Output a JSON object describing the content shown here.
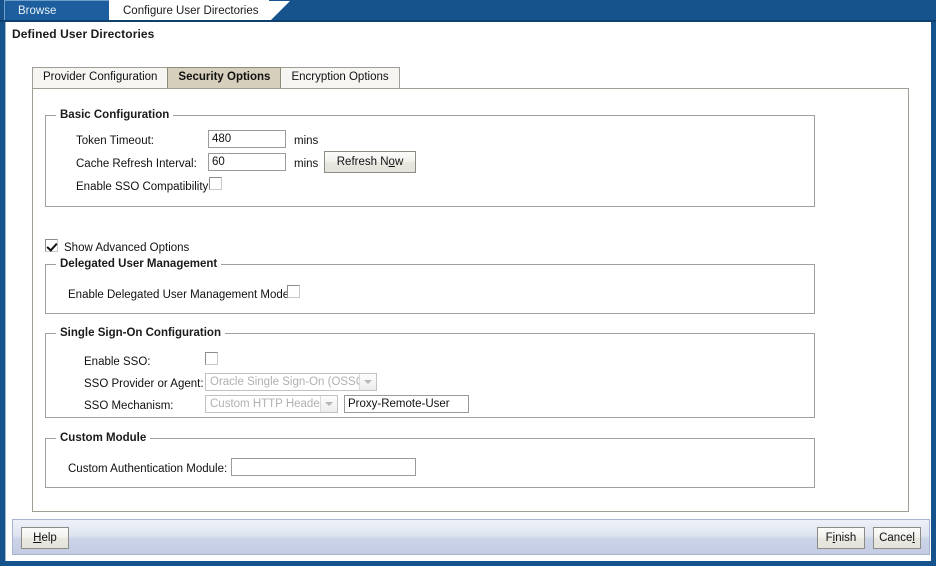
{
  "window": {
    "tabs": [
      {
        "label": "Browse",
        "active": false
      },
      {
        "label": "Configure User Directories",
        "active": true
      }
    ]
  },
  "page": {
    "title": "Defined User Directories"
  },
  "inner_tabs": [
    {
      "label": "Provider Configuration",
      "selected": false
    },
    {
      "label": "Security Options",
      "selected": true
    },
    {
      "label": "Encryption Options",
      "selected": false
    }
  ],
  "basic_configuration": {
    "legend": "Basic Configuration",
    "token_timeout": {
      "label": "Token Timeout:",
      "value": "480",
      "unit": "mins"
    },
    "cache_refresh_interval": {
      "label": "Cache Refresh Interval:",
      "value": "60",
      "unit": "mins"
    },
    "refresh_now_button": "Refresh Now",
    "enable_sso_compatibility": {
      "label": "Enable SSO Compatibility:",
      "checked": false
    }
  },
  "show_advanced_options": {
    "label": "Show Advanced Options",
    "checked": true
  },
  "delegated_user_management": {
    "legend": "Delegated User Management",
    "enable_mode": {
      "label": "Enable Delegated User Management Mode:",
      "checked": false
    }
  },
  "single_sign_on": {
    "legend": "Single Sign-On Configuration",
    "enable_sso": {
      "label": "Enable SSO:",
      "checked": false
    },
    "provider_or_agent": {
      "label": "SSO Provider or Agent:",
      "value": "Oracle Single Sign-On (OSSO)",
      "disabled": true
    },
    "mechanism": {
      "label": "SSO Mechanism:",
      "value": "Custom HTTP Header",
      "disabled": true
    },
    "header_name": {
      "value": "Proxy-Remote-User"
    }
  },
  "custom_module": {
    "legend": "Custom Module",
    "authentication_module": {
      "label": "Custom Authentication Module:",
      "value": ""
    }
  },
  "footer": {
    "help_button": "Help",
    "finish_button": "Finish",
    "cancel_button": "Cancel"
  },
  "colors": {
    "window_blue": "#16528c",
    "selected_tab": "#d5cfbc",
    "panel_border": "#9e9e94"
  }
}
